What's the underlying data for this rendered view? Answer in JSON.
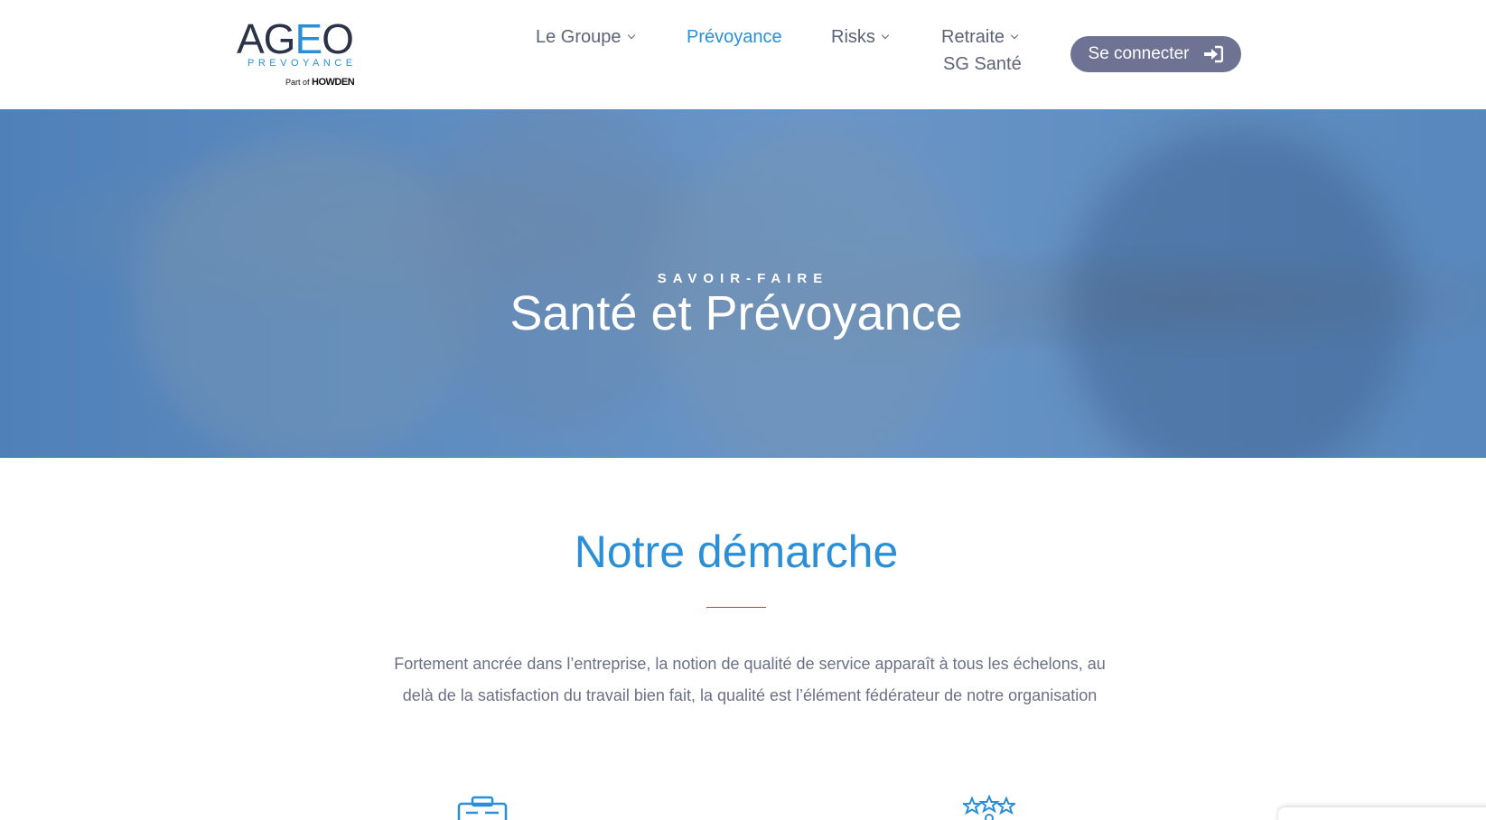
{
  "logo": {
    "brand_prefix": "AG",
    "brand_accent": "E",
    "brand_suffix": "O",
    "subtitle": "PREVOYANCE",
    "part_of": "Part of",
    "parent_brand": "HOWDEN"
  },
  "nav": {
    "items": [
      {
        "label": "Le Groupe",
        "has_dropdown": true,
        "active": false
      },
      {
        "label": "Prévoyance",
        "has_dropdown": false,
        "active": true
      },
      {
        "label": "Risks",
        "has_dropdown": true,
        "active": false
      },
      {
        "label": "Retraite",
        "has_dropdown": true,
        "active": false
      },
      {
        "label": "SG Santé",
        "has_dropdown": false,
        "active": false
      }
    ],
    "login_button": "Se connecter",
    "login_icon": "sign-in-icon"
  },
  "hero": {
    "kicker": "SAVOIR-FAIRE",
    "title": "Santé et Prévoyance"
  },
  "section": {
    "title": "Notre démarche",
    "intro": "Fortement ancrée dans l’entreprise, la notion de qualité de service apparaît à tous les échelons, au delà de la satisfaction du travail bien fait, la qualité est l’élément fédérateur de notre organisation",
    "icons": [
      "clipboard-icon",
      "stars-icon"
    ]
  },
  "colors": {
    "accent": "#2a8fd6",
    "nav_text": "#5d6378",
    "button_bg": "#6e7393",
    "divider": "#d9362f",
    "body_text": "#6b6f86"
  }
}
